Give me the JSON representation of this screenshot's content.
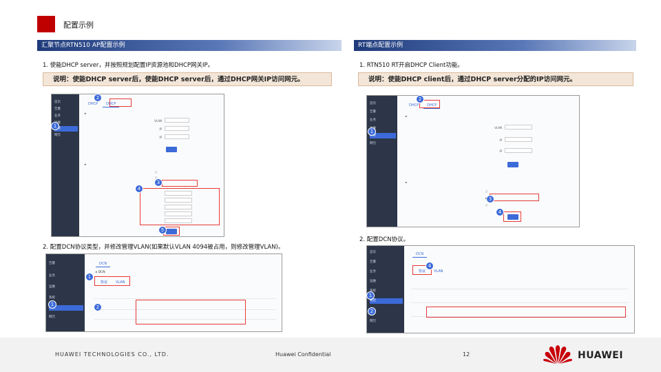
{
  "slide": {
    "title": "配置示例",
    "page_number": "12",
    "footer_company": "HUAWEI TECHNOLOGIES CO., LTD.",
    "footer_confidential": "Huawei Confidential",
    "logo_text": "HUAWEI",
    "accent_red": "#c00000"
  },
  "left": {
    "header": "汇聚节点RTN510 AP配置示例",
    "step1": "1. 使能DHCP server，并按照规划配置IP资源池和DHCP网关IP。",
    "callout1": "说明：使能DHCP server后，使能DHCP server后，通过DHCP网关IP访问网元。",
    "step2": "2. 配置DCN协议类型，并修改管理VLAN(如果默认VLAN 4094被占用，则修改管理VLAN)。",
    "badges1": [
      "1",
      "2",
      "3",
      "4",
      "5"
    ],
    "badges2": [
      "1",
      "1",
      "2"
    ]
  },
  "right": {
    "header": "RT端点配置示例",
    "step1": "1. RTN510 RT开启DHCP Client功能。",
    "callout1": "说明：使能DHCP client后，通过DHCP server分配的IP访问网元。",
    "step2": "2. 配置DCN协议。",
    "badges1": [
      "2",
      "1",
      "3",
      "4"
    ],
    "badges2": [
      "4",
      "1",
      "2"
    ]
  }
}
